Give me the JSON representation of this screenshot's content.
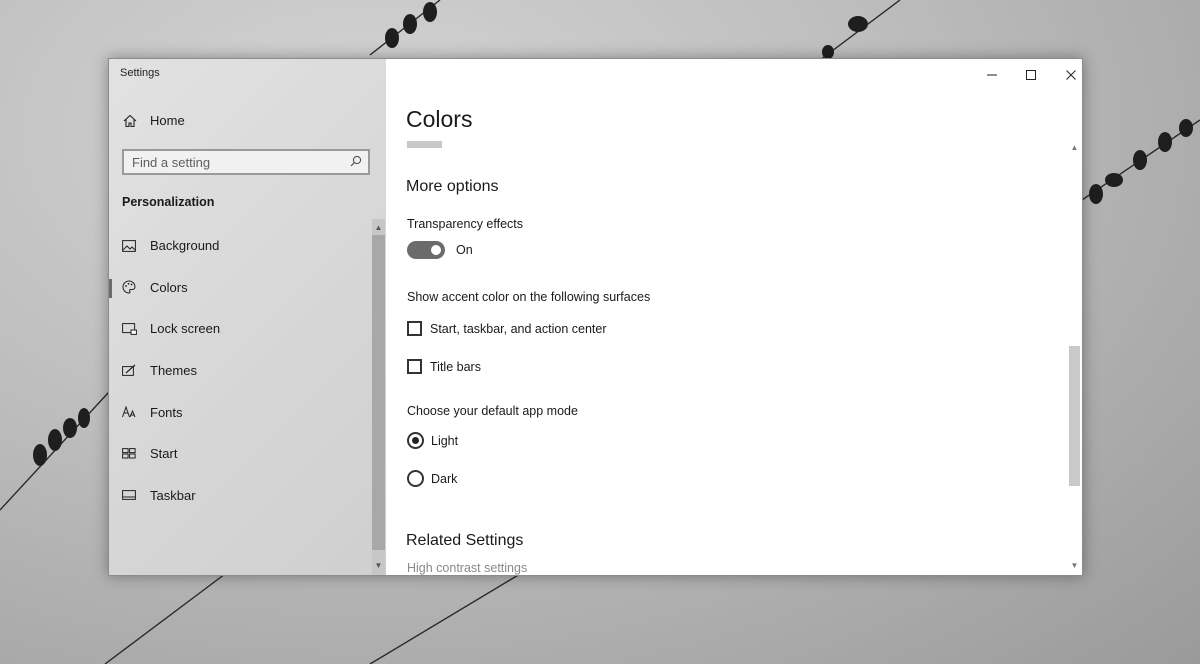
{
  "window": {
    "app_title": "Settings",
    "controls": {
      "minimize_icon": "minimize-icon",
      "maximize_icon": "maximize-icon",
      "close_icon": "close-icon"
    }
  },
  "sidebar": {
    "home_label": "Home",
    "search": {
      "placeholder": "Find a setting",
      "value": ""
    },
    "section_title": "Personalization",
    "items": [
      {
        "label": "Background",
        "icon": "image-icon",
        "active": false
      },
      {
        "label": "Colors",
        "icon": "palette-icon",
        "active": true
      },
      {
        "label": "Lock screen",
        "icon": "lock-screen-icon",
        "active": false
      },
      {
        "label": "Themes",
        "icon": "themes-icon",
        "active": false
      },
      {
        "label": "Fonts",
        "icon": "fonts-icon",
        "active": false
      },
      {
        "label": "Start",
        "icon": "start-icon",
        "active": false
      },
      {
        "label": "Taskbar",
        "icon": "taskbar-icon",
        "active": false
      }
    ]
  },
  "main": {
    "page_title": "Colors",
    "more_options": "More options",
    "transparency": {
      "label": "Transparency effects",
      "state": "On",
      "enabled": true
    },
    "accent_surfaces": {
      "label": "Show accent color on the following surfaces",
      "options": [
        {
          "label": "Start, taskbar, and action center",
          "checked": false
        },
        {
          "label": "Title bars",
          "checked": false
        }
      ]
    },
    "app_mode": {
      "label": "Choose your default app mode",
      "options": [
        {
          "label": "Light",
          "selected": true
        },
        {
          "label": "Dark",
          "selected": false
        }
      ]
    },
    "related": {
      "title": "Related Settings",
      "link": "High contrast settings"
    }
  },
  "colors": {
    "toggle_on": "#6b6b6b",
    "accent_swatch": "#c8c8c8",
    "link": "#8a8a8a"
  }
}
